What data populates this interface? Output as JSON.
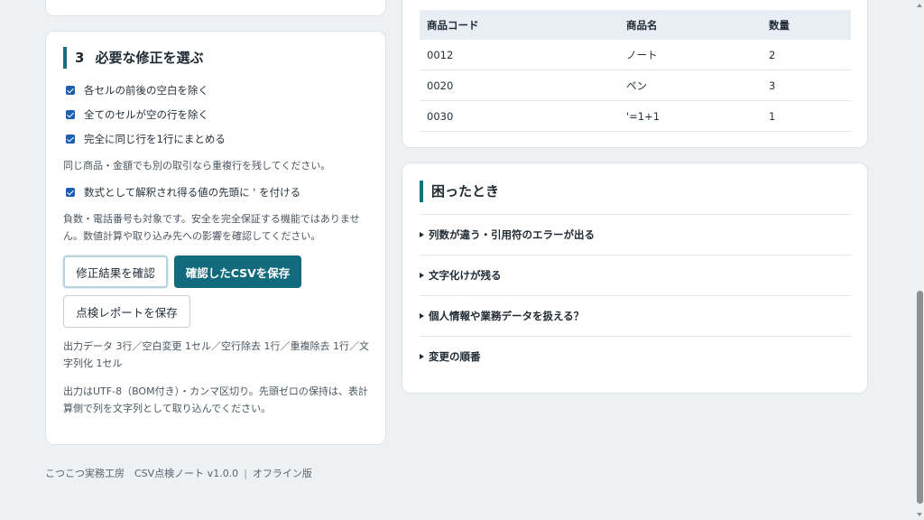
{
  "fix_section": {
    "number": "3",
    "title": "必要な修正を選ぶ",
    "options": [
      {
        "label": "各セルの前後の空白を除く",
        "checked": true
      },
      {
        "label": "全てのセルが空の行を除く",
        "checked": true
      },
      {
        "label": "完全に同じ行を1行にまとめる",
        "checked": true
      }
    ],
    "duplicate_note": "同じ商品・金額でも別の取引なら重複行を残してください。",
    "formula_option": {
      "label": "数式として解釈され得る値の先頭に ' を付ける",
      "checked": true
    },
    "formula_note": "負数・電話番号も対象です。安全を完全保証する機能ではありません。数値計算や取り込み先への影響を確認してください。",
    "buttons": {
      "preview": "修正結果を確認",
      "save_csv": "確認したCSVを保存",
      "save_report": "点検レポートを保存"
    },
    "summary": "出力データ 3行／空白変更 1セル／空行除去 1行／重複除去 1行／文字列化 1セル",
    "output_note": "出力はUTF-8（BOM付き）・カンマ区切り。先頭ゼロの保持は、表計算側で列を文字列として取り込んでください。"
  },
  "preview_table": {
    "headers": [
      "商品コード",
      "商品名",
      "数量"
    ],
    "rows": [
      [
        "0012",
        "ノート",
        "2"
      ],
      [
        "0020",
        "ペン",
        "3"
      ],
      [
        "0030",
        "'=1+1",
        "1"
      ]
    ]
  },
  "help_section": {
    "title": "困ったとき",
    "items": [
      "列数が違う・引用符のエラーが出る",
      "文字化けが残る",
      "個人情報や業務データを扱える？",
      "変更の順番"
    ]
  },
  "footer": {
    "product": "こつこつ実務工房　CSV点検ノート v1.0.0",
    "separator": "|",
    "mode": "オフライン版"
  },
  "colors": {
    "accent": "#126b7c",
    "checkbox": "#1a5fb4",
    "background": "#eef1f4"
  }
}
